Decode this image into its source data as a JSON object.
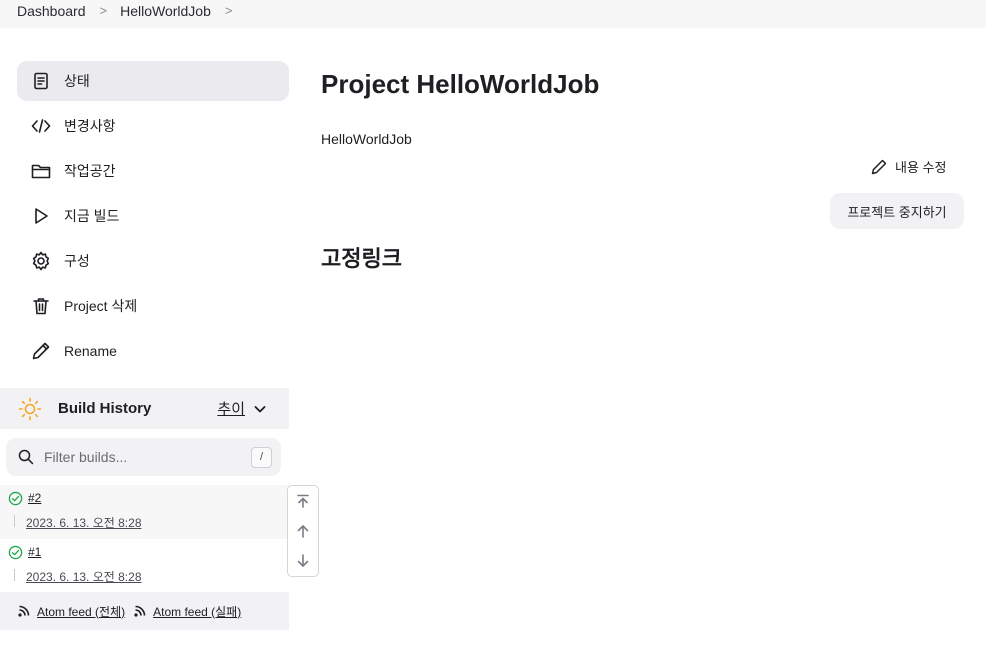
{
  "breadcrumb": {
    "items": [
      "Dashboard",
      "HelloWorldJob"
    ]
  },
  "sidebar": {
    "items": [
      {
        "label": "상태",
        "icon": "document-icon",
        "active": true
      },
      {
        "label": "변경사항",
        "icon": "code-icon"
      },
      {
        "label": "작업공간",
        "icon": "folder-icon"
      },
      {
        "label": "지금 빌드",
        "icon": "play-icon"
      },
      {
        "label": "구성",
        "icon": "gear-icon"
      },
      {
        "label": "Project 삭제",
        "icon": "trash-icon"
      },
      {
        "label": "Rename",
        "icon": "pencil-icon"
      }
    ]
  },
  "build_history": {
    "title": "Build History",
    "trend_label": "추이",
    "filter_placeholder": "Filter builds...",
    "filter_shortcut": "/",
    "builds": [
      {
        "number": "#2",
        "date": "2023. 6. 13. 오전 8:28",
        "status": "success"
      },
      {
        "number": "#1",
        "date": "2023. 6. 13. 오전 8:28",
        "status": "success"
      }
    ],
    "atom_all": "Atom feed (전체)",
    "atom_failed": "Atom feed (실패)"
  },
  "main": {
    "title": "Project HelloWorldJob",
    "description": "HelloWorldJob",
    "edit_description_label": "내용 수정",
    "disable_project_label": "프로젝트 중지하기",
    "permalinks_heading": "고정링크"
  },
  "colors": {
    "success": "#1ea64b",
    "sun": "#f5a623"
  }
}
